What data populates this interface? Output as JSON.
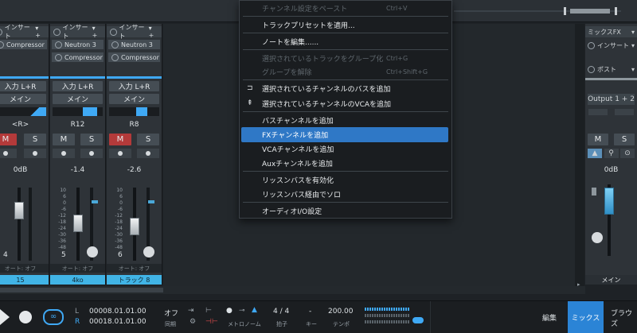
{
  "mixer": {
    "channels": [
      {
        "insert_label": "インサート",
        "plugin1": "Compressor",
        "plugin2": "",
        "input": "入力 L+R",
        "output": "メイン",
        "pan": "<R>",
        "mute": "M",
        "solo": "S",
        "volume": "0dB",
        "number": "4",
        "automation": "オート: オフ",
        "name": "15"
      },
      {
        "insert_label": "インサート",
        "plugin1": "Neutron 3",
        "plugin2": "Compressor",
        "input": "入力 L+R",
        "output": "メイン",
        "pan": "R12",
        "mute": "M",
        "solo": "S",
        "volume": "-1.4",
        "number": "5",
        "automation": "オート: オフ",
        "name": "4ko"
      },
      {
        "insert_label": "インサート",
        "plugin1": "Neutron 3",
        "plugin2": "Compressor",
        "input": "入力 L+R",
        "output": "メイン",
        "pan": "R8",
        "mute": "M",
        "solo": "S",
        "volume": "-2.6",
        "number": "6",
        "automation": "オート: オフ",
        "name": "トラック 8"
      }
    ],
    "scale": [
      "10",
      "6",
      "0",
      "-6",
      "-12",
      "-18",
      "-24",
      "-30",
      "-36",
      "-48"
    ],
    "right_strip": {
      "fx_label": "ミックスFX",
      "insert_label": "インサート",
      "post_label": "ポスト",
      "output": "Output 1 + 2",
      "mute": "M",
      "solo": "S",
      "volume": "0dB",
      "name": "メイン"
    }
  },
  "context_menu": {
    "items": [
      {
        "label": "チャンネル設定をペースト",
        "shortcut": "Ctrl+V",
        "disabled": true
      },
      {
        "label": "トラックプリセットを適用...",
        "shortcut": "",
        "disabled": false
      },
      {
        "label": "ノートを編集......",
        "shortcut": "",
        "disabled": false
      },
      {
        "label": "選択されているトラックをグループ化",
        "shortcut": "Ctrl+G",
        "disabled": true
      },
      {
        "label": "グループを解除",
        "shortcut": "Ctrl+Shift+G",
        "disabled": true
      },
      {
        "label": "選択されているチャンネルのバスを追加",
        "shortcut": "",
        "disabled": false
      },
      {
        "label": "選択されているチャンネルのVCAを追加",
        "shortcut": "",
        "disabled": false
      },
      {
        "label": "バスチャンネルを追加",
        "shortcut": "",
        "disabled": false
      },
      {
        "label": "FXチャンネルを追加",
        "shortcut": "",
        "disabled": false,
        "highlighted": true
      },
      {
        "label": "VCAチャンネルを追加",
        "shortcut": "",
        "disabled": false
      },
      {
        "label": "Auxチャンネルを追加",
        "shortcut": "",
        "disabled": false
      },
      {
        "label": "リッスンバスを有効化",
        "shortcut": "",
        "disabled": false
      },
      {
        "label": "リッスンバス経由でソロ",
        "shortcut": "",
        "disabled": false
      },
      {
        "label": "オーディオI/O設定",
        "shortcut": "",
        "disabled": false
      }
    ]
  },
  "transport": {
    "loop_l_label": "L",
    "loop_r_label": "R",
    "loop_start": "00008.01.01.00",
    "loop_end": "00018.01.01.00",
    "sync_value": "オフ",
    "sync_label": "同期",
    "metronome_label": "メトロノーム",
    "time_signature": "4 / 4",
    "time_signature_label": "拍子",
    "key_value": "-",
    "key_label": "キー",
    "tempo_value": "200.00",
    "tempo_label": "テンポ"
  },
  "view_tabs": [
    "編集",
    "ミックス",
    "ブラウズ"
  ],
  "colors": {
    "accent": "#41b4e6",
    "menu_highlight": "#2f78c6",
    "mute_active": "#b33a3a",
    "active_tab": "#2b84d6"
  }
}
